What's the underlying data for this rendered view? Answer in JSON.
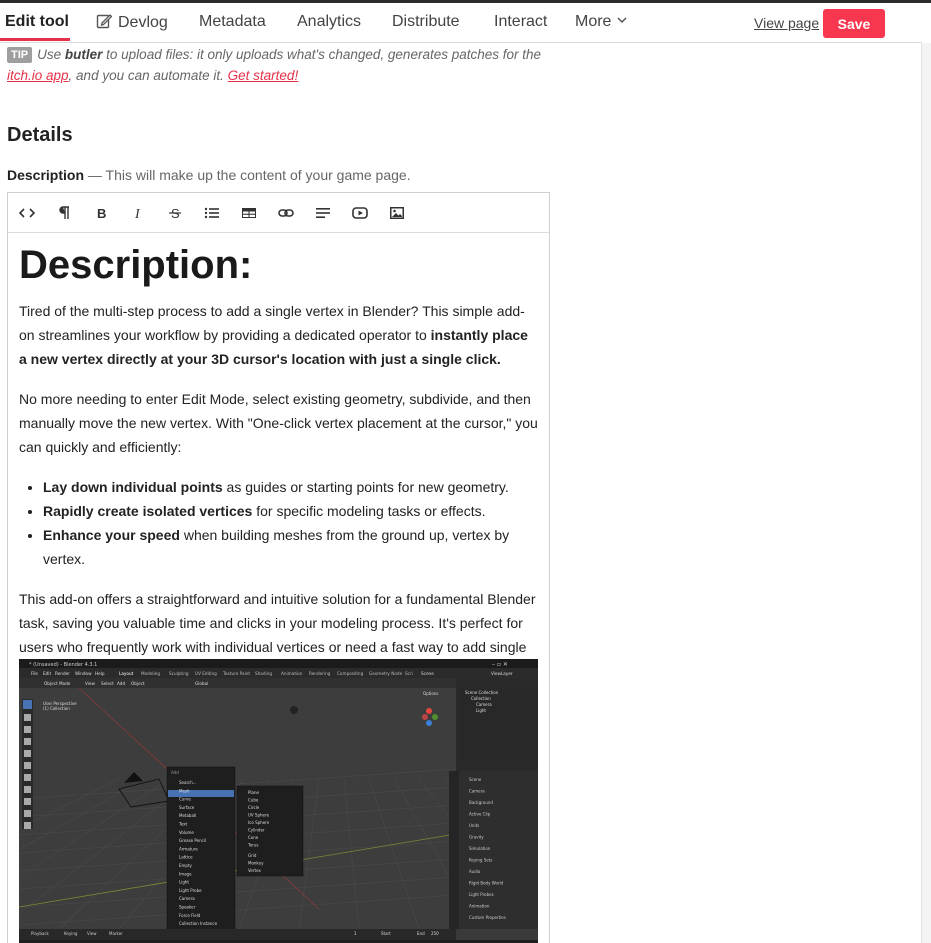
{
  "nav": {
    "tabs": [
      "Edit tool",
      "Devlog",
      "Metadata",
      "Analytics",
      "Distribute",
      "Interact",
      "More"
    ],
    "view_page": "View page",
    "save": "Save"
  },
  "tip": {
    "badge": "TIP",
    "t1": "Use ",
    "butler": "butler",
    "t2": " to upload files: it only uploads what's changed, generates patches for the ",
    "itch_link": "itch.io app",
    "t3": ", and you can automate it. ",
    "get_started": "Get started!"
  },
  "details": {
    "heading": "Details",
    "desc_label": "Description",
    "desc_hint": " — This will make up the content of your game page."
  },
  "content": {
    "h1": "Description:",
    "p1a": "Tired of the multi-step process to add a single vertex in Blender? This simple add-on streamlines your workflow by providing a dedicated operator to ",
    "p1b": "instantly place a new vertex directly at your 3D cursor's location with just a single click.",
    "p2": "No more needing to enter Edit Mode, select existing geometry, subdivide, and then manually move the new vertex. With \"One-click vertex placement at the cursor,\" you can quickly and efficiently:",
    "bullets": [
      {
        "b": "Lay down individual points",
        "t": " as guides or starting points for new geometry."
      },
      {
        "b": "Rapidly create isolated vertices",
        "t": " for specific modeling tasks or effects."
      },
      {
        "b": "Enhance your speed",
        "t": " when building meshes from the ground up, vertex by vertex."
      }
    ],
    "p3": "This add-on offers a straightforward and intuitive solution for a fundamental Blender task, saving you valuable time and clicks in your modeling process. It's perfect for users who frequently work with individual vertices or need a fast way to add single points in their scenes."
  },
  "screenshot": {
    "title": "* (Unsaved) - Blender 4.3.1",
    "menu": [
      "File",
      "Edit",
      "Render",
      "Window",
      "Help"
    ],
    "workspaces": [
      "Layout",
      "Modeling",
      "Sculpting",
      "UV Editing",
      "Texture Paint",
      "Shading",
      "Animation",
      "Rendering",
      "Compositing",
      "Geometry Node",
      "Scri"
    ],
    "viewport_info": [
      "User Perspective",
      "(1) Collection"
    ],
    "add_menu_title": "Add",
    "add_menu": [
      "Search...",
      "Mesh",
      "Curve",
      "Surface",
      "Metaball",
      "Text",
      "Volume",
      "Grease Pencil",
      "Armature",
      "Lattice",
      "Empty",
      "Image",
      "Light",
      "Light Probe",
      "Camera",
      "Speaker",
      "Force Field",
      "Collection Instance"
    ],
    "mesh_menu": [
      "Plane",
      "Cube",
      "Circle",
      "UV Sphere",
      "Ico Sphere",
      "Cylinder",
      "Cone",
      "Torus",
      "Grid",
      "Monkey",
      "Vertex"
    ],
    "outliner": [
      "Scene Collection",
      "Collection",
      "Camera",
      "Light"
    ],
    "props": [
      "Scene",
      "Camera",
      "Background",
      "Active Clip",
      "Units",
      "Gravity",
      "Simulation",
      "Keying Sets",
      "Audio",
      "Rigid Body World",
      "Light Probes",
      "Animation",
      "Custom Properties"
    ],
    "timeline": [
      "Playback",
      "Keying",
      "View",
      "Marker"
    ],
    "view_layer": "ViewLayer",
    "scene_label": "Scene",
    "options": "Options",
    "global": "Global",
    "object_mode": "Object Mode",
    "vp_menu": [
      "View",
      "Select",
      "Add",
      "Object"
    ],
    "frame_start": "Start",
    "frame_end": "End",
    "frame_cur": "1",
    "frame_end_val": "250"
  },
  "colors": {
    "accent": "#f7374f",
    "link": "#e6314a"
  }
}
